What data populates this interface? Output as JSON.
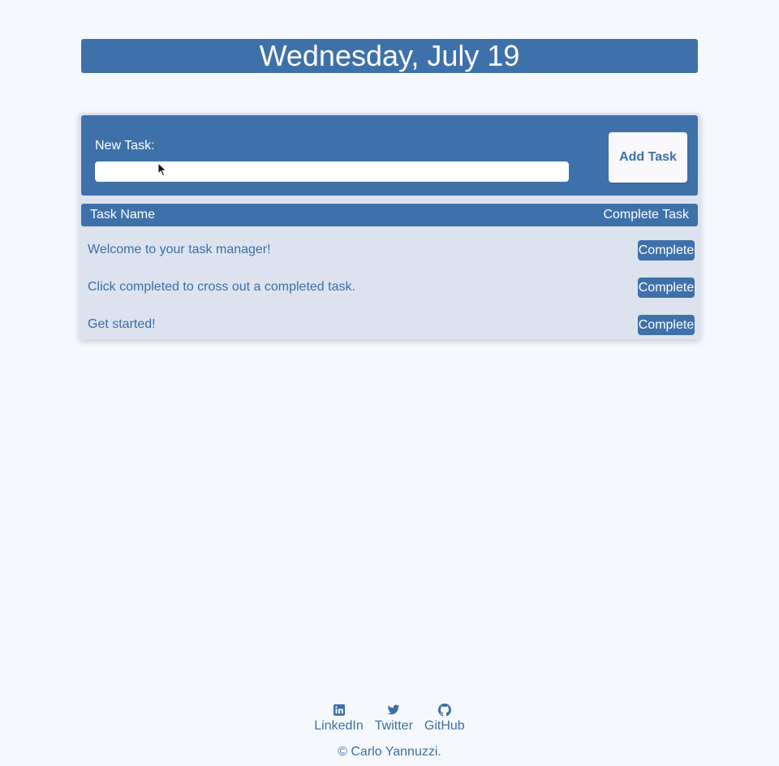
{
  "header": {
    "date": "Wednesday, July 19"
  },
  "form": {
    "label": "New Task:",
    "input_value": "",
    "input_placeholder": "",
    "add_button_label": "Add Task"
  },
  "table": {
    "columns": [
      "Task Name",
      "Complete Task"
    ],
    "tasks": [
      {
        "name": "Welcome to your task manager!",
        "action": "Complete"
      },
      {
        "name": "Click completed to cross out a completed task.",
        "action": "Complete"
      },
      {
        "name": "Get started!",
        "action": "Complete"
      }
    ]
  },
  "footer": {
    "links": [
      {
        "label": "LinkedIn",
        "icon": "linkedin-icon"
      },
      {
        "label": "Twitter",
        "icon": "twitter-icon"
      },
      {
        "label": "GitHub",
        "icon": "github-icon"
      }
    ],
    "copyright": "© Carlo Yannuzzi."
  },
  "colors": {
    "background": "#f5f9fd",
    "primary": "#3e71aa",
    "panel": "#dce3ee",
    "text": "#3b6ea7",
    "button_light": "#f9f8fc"
  }
}
